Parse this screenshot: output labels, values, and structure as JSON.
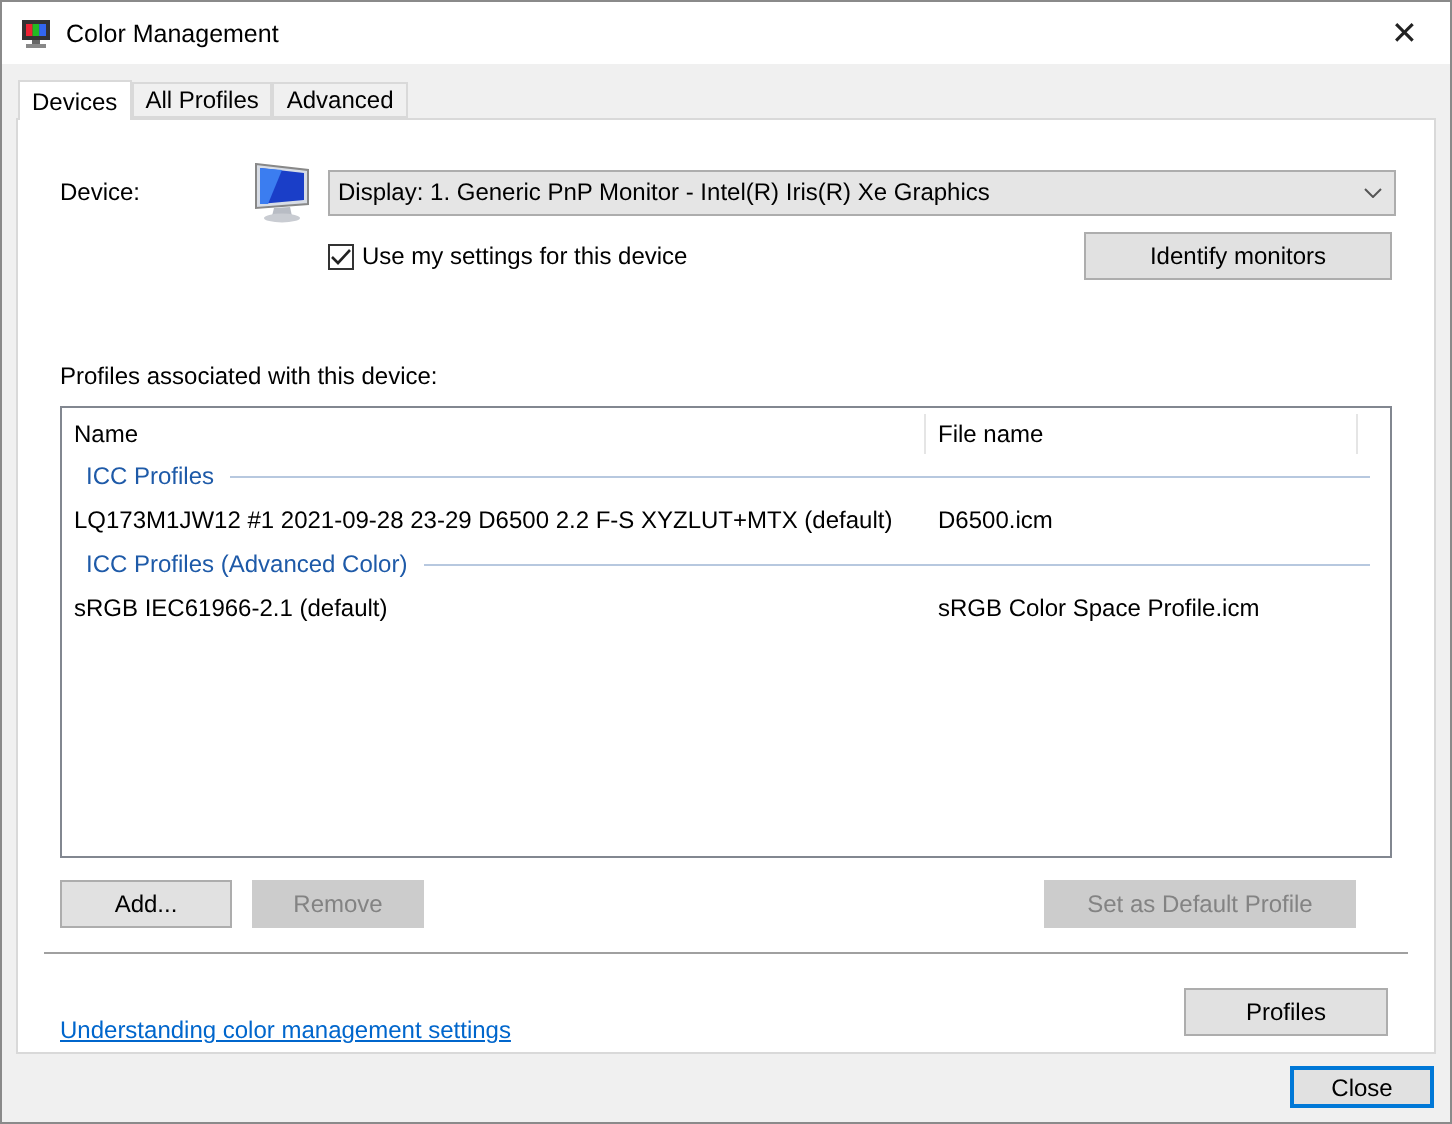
{
  "window": {
    "title": "Color Management",
    "close": "✕"
  },
  "tabs": [
    {
      "label": "Devices",
      "selected": true
    },
    {
      "label": "All Profiles",
      "selected": false
    },
    {
      "label": "Advanced",
      "selected": false
    }
  ],
  "device": {
    "label": "Device:",
    "value": "Display: 1. Generic PnP Monitor - Intel(R) Iris(R) Xe Graphics"
  },
  "use_my_settings": {
    "label": "Use my settings for this device",
    "checked": true
  },
  "identify_button": {
    "label": "Identify monitors",
    "disabled": false
  },
  "profiles_label": "Profiles associated with this device:",
  "table": {
    "columns": [
      "Name",
      "File name"
    ],
    "groups": [
      {
        "title": "ICC Profiles",
        "rows": [
          {
            "name": "LQ173M1JW12 #1 2021-09-28 23-29 D6500 2.2 F-S XYZLUT+MTX (default)",
            "file": "D6500.icm"
          }
        ]
      },
      {
        "title": "ICC Profiles (Advanced Color)",
        "rows": [
          {
            "name": "sRGB IEC61966-2.1 (default)",
            "file": "sRGB Color Space Profile.icm"
          }
        ]
      }
    ]
  },
  "list_buttons": [
    {
      "label": "Add...",
      "disabled": false
    },
    {
      "label": "Remove",
      "disabled": true
    },
    {
      "label": "Set as Default Profile",
      "disabled": true
    }
  ],
  "link": "Understanding color management settings",
  "profiles_button": {
    "label": "Profiles",
    "disabled": false
  },
  "close_button": {
    "label": "Close",
    "default": true
  }
}
